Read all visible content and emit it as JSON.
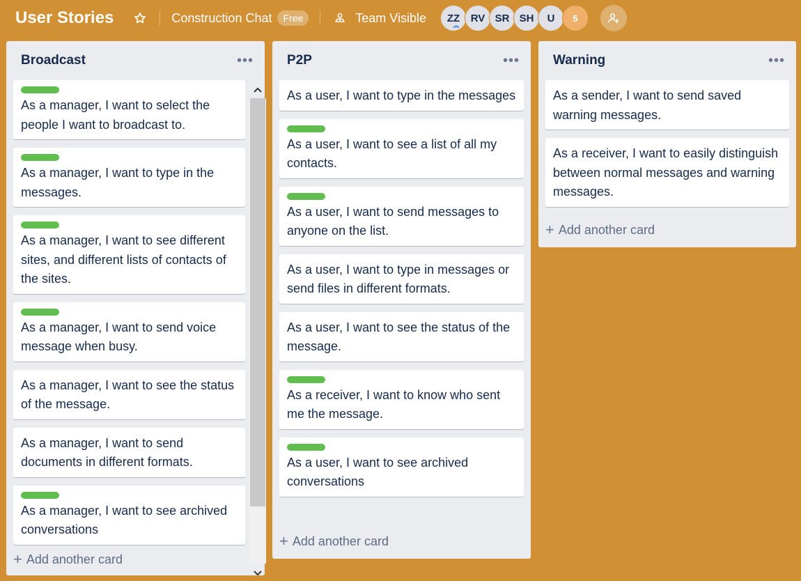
{
  "header": {
    "board_title": "User Stories",
    "board_name": "Construction Chat",
    "plan_badge": "Free",
    "visibility": "Team Visible",
    "members": [
      "ZZ",
      "RV",
      "SR",
      "SH",
      "U"
    ],
    "more_members": "5",
    "icons": {
      "star": "star-icon",
      "visibility": "team-icon",
      "invite": "add-member-icon"
    }
  },
  "lists": {
    "broadcast": {
      "title": "Broadcast",
      "cards": [
        {
          "label": true,
          "text": "As a manager, I want to select the people I want to broadcast to."
        },
        {
          "label": true,
          "text": "As a manager, I want to type in the messages."
        },
        {
          "label": true,
          "text": "As a manager, I want to see different sites, and different lists of contacts of the sites."
        },
        {
          "label": true,
          "text": "As a manager, I want to send voice message when busy."
        },
        {
          "label": false,
          "text": "As a manager, I want to see the status of the message."
        },
        {
          "label": false,
          "text": "As a manager, I want to send documents in different formats."
        },
        {
          "label": true,
          "text": "As a manager, I want to see archived conversations"
        }
      ],
      "add_card": "Add another card"
    },
    "p2p": {
      "title": "P2P",
      "cards": [
        {
          "label": false,
          "text": "As a user, I want to type in the messages"
        },
        {
          "label": true,
          "text": "As a user, I want to see a list of all my contacts."
        },
        {
          "label": true,
          "text": "As a user, I want to send messages to anyone on the list."
        },
        {
          "label": false,
          "text": "As a user, I want to type in messages or send files in different formats."
        },
        {
          "label": false,
          "text": "As a user, I want to see the status of the message."
        },
        {
          "label": true,
          "text": "As a receiver, I want to know who sent me the message."
        },
        {
          "label": true,
          "text": "As a user, I want to see archived conversations"
        }
      ],
      "add_card": "Add another card"
    },
    "warning": {
      "title": "Warning",
      "cards": [
        {
          "label": false,
          "text": "As a sender, I want to send saved warning messages."
        },
        {
          "label": false,
          "text": "As a receiver, I want to easily distinguish between normal messages and warning messages."
        }
      ],
      "add_card": "Add another card"
    }
  },
  "colors": {
    "background": "#d29034",
    "label_green": "#61bd4f",
    "list_bg": "#ebecf0"
  }
}
